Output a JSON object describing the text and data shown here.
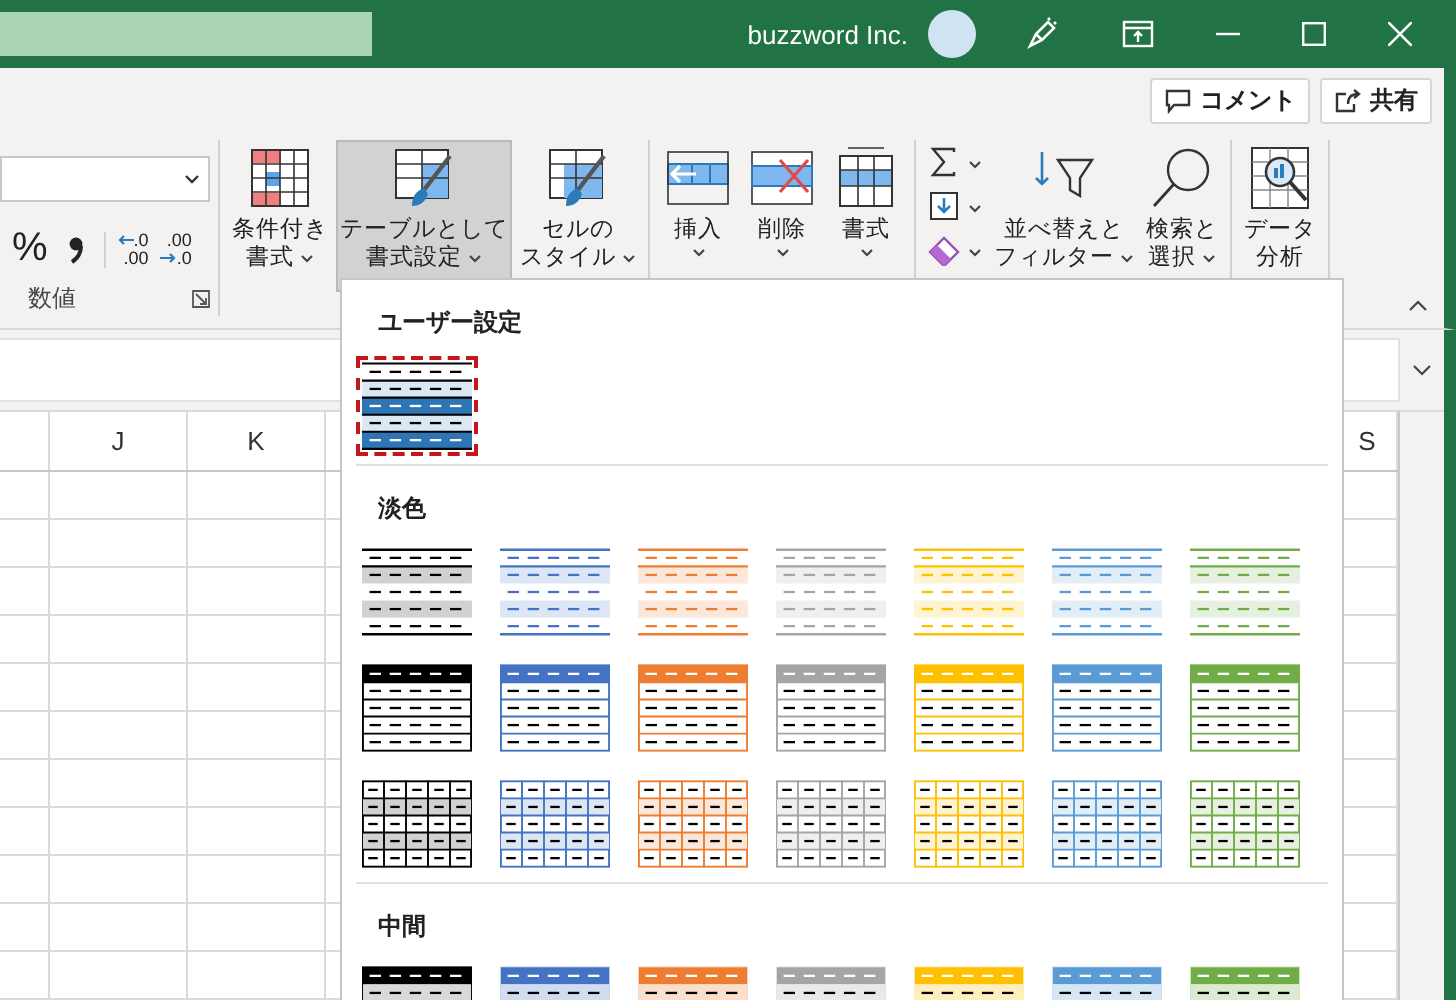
{
  "title_bar": {
    "account": "buzzword Inc."
  },
  "header_buttons": [
    {
      "kind": "comment",
      "label": "コメント"
    },
    {
      "kind": "share",
      "label": "共有"
    }
  ],
  "ribbon": {
    "number_group": {
      "label": "数値",
      "buttons": [
        {
          "kind": "percent",
          "text": "%"
        },
        {
          "kind": "comma"
        },
        {
          "kind": "decimal-increase",
          "upper": ".0",
          "lower": ".00"
        },
        {
          "kind": "decimal-decrease",
          "upper": ".00",
          "lower": ".0"
        }
      ]
    },
    "groups": [
      {
        "items": [
          {
            "kind": "conditional-format",
            "lines": [
              "条件付き",
              "書式"
            ],
            "dropdown": true,
            "pressed": false
          },
          {
            "kind": "format-as-table",
            "lines": [
              "テーブルとして",
              "書式設定"
            ],
            "dropdown": true,
            "pressed": true
          },
          {
            "kind": "cell-styles",
            "lines": [
              "セルの",
              "スタイル"
            ],
            "dropdown": true,
            "pressed": false
          }
        ]
      },
      {
        "items": [
          {
            "kind": "insert",
            "lines": [
              "挿入"
            ],
            "dropdown": true,
            "pressed": false
          },
          {
            "kind": "delete",
            "lines": [
              "削除"
            ],
            "dropdown": true,
            "pressed": false
          },
          {
            "kind": "format",
            "lines": [
              "書式"
            ],
            "dropdown": true,
            "pressed": false
          }
        ]
      },
      {
        "items": [
          {
            "kind": "edit-stack",
            "buttons": [
              {
                "kind": "autosum"
              },
              {
                "kind": "fill"
              },
              {
                "kind": "clear"
              }
            ]
          },
          {
            "kind": "sort-filter",
            "lines": [
              "並べ替えと",
              "フィルター"
            ],
            "dropdown": true,
            "pressed": false
          },
          {
            "kind": "find-select",
            "lines": [
              "検索と",
              "選択"
            ],
            "dropdown": true,
            "pressed": false
          }
        ]
      },
      {
        "items": [
          {
            "kind": "data-analysis",
            "lines": [
              "データ",
              "分析"
            ],
            "dropdown": false,
            "pressed": false
          }
        ]
      }
    ]
  },
  "sheet": {
    "columns": [
      {
        "label": "J"
      },
      {
        "label": "K"
      },
      {
        "label": "S"
      }
    ]
  },
  "gallery": {
    "sections": [
      {
        "title": "ユーザー設定",
        "styles": [
          {
            "kind": "custom",
            "color": "#2e75b6",
            "highlighted": true
          }
        ]
      },
      {
        "title": "淡色",
        "styles": [
          {
            "kind": "light-banded",
            "color": "#000000",
            "highlighted": false
          },
          {
            "kind": "light-banded",
            "color": "#4472c4",
            "highlighted": false
          },
          {
            "kind": "light-banded",
            "color": "#ed7d31",
            "highlighted": false
          },
          {
            "kind": "light-banded",
            "color": "#a5a5a5",
            "highlighted": false
          },
          {
            "kind": "light-banded",
            "color": "#ffc000",
            "highlighted": false
          },
          {
            "kind": "light-banded",
            "color": "#5b9bd5",
            "highlighted": false
          },
          {
            "kind": "light-banded",
            "color": "#70ad47",
            "highlighted": false
          },
          {
            "kind": "light-header",
            "color": "#000000",
            "highlighted": false
          },
          {
            "kind": "light-header",
            "color": "#4472c4",
            "highlighted": false
          },
          {
            "kind": "light-header",
            "color": "#ed7d31",
            "highlighted": false
          },
          {
            "kind": "light-header",
            "color": "#a5a5a5",
            "highlighted": false
          },
          {
            "kind": "light-header",
            "color": "#ffc000",
            "highlighted": false
          },
          {
            "kind": "light-header",
            "color": "#5b9bd5",
            "highlighted": false
          },
          {
            "kind": "light-header",
            "color": "#70ad47",
            "highlighted": false
          },
          {
            "kind": "light-grid",
            "color": "#000000",
            "highlighted": false
          },
          {
            "kind": "light-grid",
            "color": "#4472c4",
            "highlighted": false
          },
          {
            "kind": "light-grid",
            "color": "#ed7d31",
            "highlighted": false
          },
          {
            "kind": "light-grid",
            "color": "#a5a5a5",
            "highlighted": false
          },
          {
            "kind": "light-grid",
            "color": "#ffc000",
            "highlighted": false
          },
          {
            "kind": "light-grid",
            "color": "#5b9bd5",
            "highlighted": false
          },
          {
            "kind": "light-grid",
            "color": "#70ad47",
            "highlighted": false
          }
        ]
      },
      {
        "title": "中間",
        "styles": [
          {
            "kind": "medium-banded",
            "color": "#000000",
            "highlighted": false
          },
          {
            "kind": "medium-banded",
            "color": "#4472c4",
            "highlighted": false
          },
          {
            "kind": "medium-banded",
            "color": "#ed7d31",
            "highlighted": false
          },
          {
            "kind": "medium-banded",
            "color": "#a5a5a5",
            "highlighted": false
          },
          {
            "kind": "medium-banded",
            "color": "#ffc000",
            "highlighted": false
          },
          {
            "kind": "medium-banded",
            "color": "#5b9bd5",
            "highlighted": false
          },
          {
            "kind": "medium-banded",
            "color": "#70ad47",
            "highlighted": false
          }
        ]
      }
    ]
  }
}
